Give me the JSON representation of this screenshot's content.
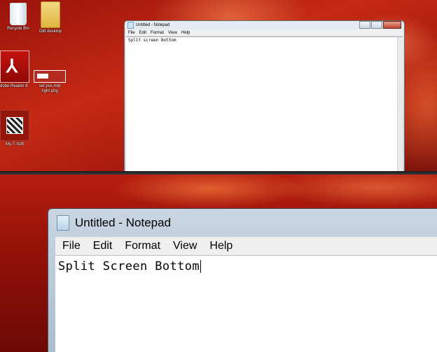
{
  "desktop": {
    "icons": [
      {
        "label": "Recycle Bin"
      },
      {
        "label": "Old desktop"
      },
      {
        "label": "dobe Reader 8"
      },
      {
        "label": "set pos mid right.png"
      },
      {
        "label": "My-T-Soft"
      }
    ]
  },
  "small_notepad": {
    "title": "Untitled - Notepad",
    "menu": [
      "File",
      "Edit",
      "Format",
      "View",
      "Help"
    ],
    "content": "Split screen Bottom"
  },
  "big_notepad": {
    "title": "Untitled - Notepad",
    "menu": [
      "File",
      "Edit",
      "Format",
      "View",
      "Help"
    ],
    "content": "Split Screen Bottom"
  }
}
